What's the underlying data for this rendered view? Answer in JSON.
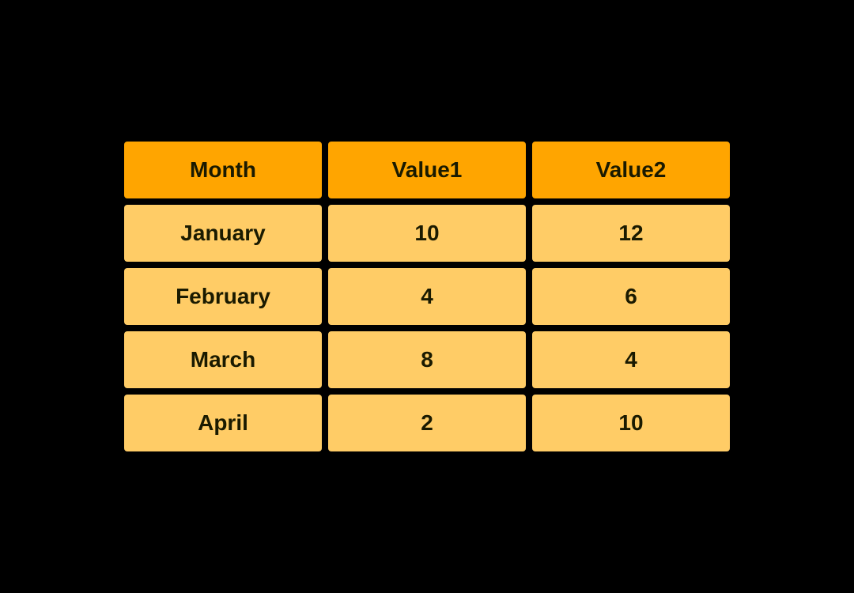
{
  "table": {
    "headers": [
      {
        "label": "Month",
        "key": "month-header"
      },
      {
        "label": "Value1",
        "key": "value1-header"
      },
      {
        "label": "Value2",
        "key": "value2-header"
      }
    ],
    "rows": [
      {
        "month": "January",
        "value1": "10",
        "value2": "12"
      },
      {
        "month": "February",
        "value1": "4",
        "value2": "6"
      },
      {
        "month": "March",
        "value1": "8",
        "value2": "4"
      },
      {
        "month": "April",
        "value1": "2",
        "value2": "10"
      }
    ]
  }
}
